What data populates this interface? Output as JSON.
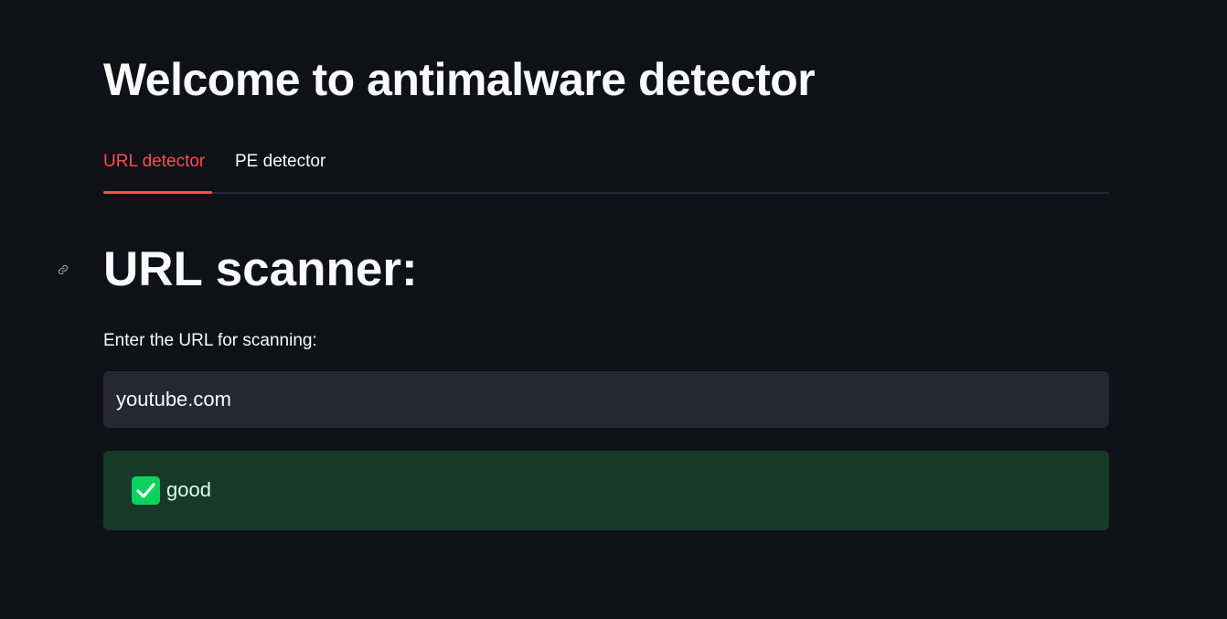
{
  "app": {
    "title": "Welcome to antimalware detector"
  },
  "tabs": [
    {
      "label": "URL detector",
      "active": true
    },
    {
      "label": "PE detector",
      "active": false
    }
  ],
  "url_section": {
    "title": "URL scanner:",
    "input_label": "Enter the URL for scanning:",
    "input_value": "youtube.com",
    "result": {
      "status": "success",
      "icon": "check-icon",
      "text": "good"
    }
  },
  "colors": {
    "background": "#0e1117",
    "accent": "#ff4b4b",
    "input_bg": "#262730",
    "success_bg": "#173928",
    "success_icon": "#09d35a"
  }
}
